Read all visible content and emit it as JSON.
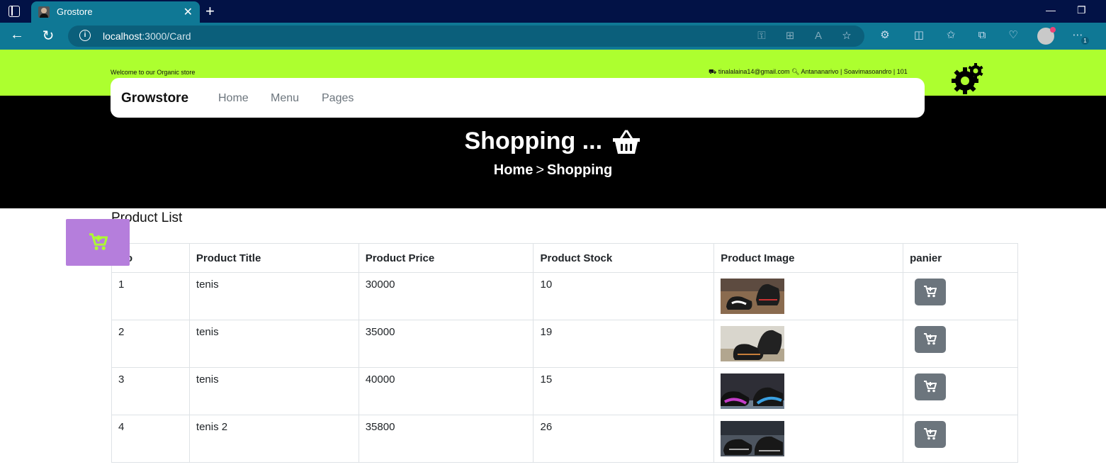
{
  "browser": {
    "tab_title": "Grostore",
    "url_host": "localhost",
    "url_path": ":3000/Card",
    "notification_count": "1"
  },
  "topbar": {
    "welcome": "Welcome to our Organic store",
    "contact": "tinalalaina14@gmail.com",
    "address": "Antananarivo | Soavimasoandro | 101"
  },
  "nav": {
    "brand": "Growstore",
    "links": [
      "Home",
      "Menu",
      "Pages"
    ]
  },
  "hero": {
    "title": "Shopping ...",
    "breadcrumb_home": "Home",
    "breadcrumb_current": "Shopping"
  },
  "products": {
    "title": "Product List",
    "headers": [
      "No",
      "Product Title",
      "Product Price",
      "Product Stock",
      "Product Image",
      "panier"
    ],
    "rows": [
      {
        "no": "1",
        "title": "tenis",
        "price": "30000",
        "stock": "10"
      },
      {
        "no": "2",
        "title": "tenis",
        "price": "35000",
        "stock": "19"
      },
      {
        "no": "3",
        "title": "tenis",
        "price": "40000",
        "stock": "15"
      },
      {
        "no": "4",
        "title": "tenis 2",
        "price": "35800",
        "stock": "26"
      }
    ]
  },
  "colors": {
    "accent": "#adff2f",
    "hero_bg": "#000000",
    "float_cart": "#b57edc",
    "cart_button": "#6c757d",
    "browser_tab": "#0f7895",
    "browser_frame": "#021246"
  }
}
